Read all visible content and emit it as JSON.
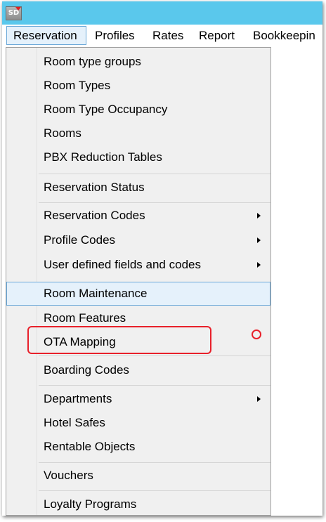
{
  "app": {
    "icon_text": "SD"
  },
  "menubar": {
    "items": [
      {
        "label": "Reservation",
        "active": true
      },
      {
        "label": "Profiles"
      },
      {
        "label": "Rates"
      },
      {
        "label": "Report"
      },
      {
        "label": "Bookkeepin"
      }
    ]
  },
  "dropdown": {
    "items": [
      {
        "label": "Room type groups"
      },
      {
        "label": "Room Types"
      },
      {
        "label": "Room Type Occupancy"
      },
      {
        "label": "Rooms"
      },
      {
        "label": "PBX Reduction Tables"
      },
      {
        "label": "Reservation Status"
      },
      {
        "label": "Reservation Codes",
        "has_submenu": true
      },
      {
        "label": "Profile Codes",
        "has_submenu": true
      },
      {
        "label": "User defined fields and codes",
        "has_submenu": true
      },
      {
        "label": "Room Maintenance",
        "highlighted": true
      },
      {
        "label": "Room Features"
      },
      {
        "label": "OTA Mapping",
        "annotated": true
      },
      {
        "label": "Boarding Codes"
      },
      {
        "label": "Departments",
        "has_submenu": true
      },
      {
        "label": "Hotel Safes"
      },
      {
        "label": "Rentable Objects"
      },
      {
        "label": "Vouchers"
      },
      {
        "label": "Loyalty Programs"
      }
    ]
  },
  "colors": {
    "titlebar": "#5ac8ec",
    "menu_background": "#f0f0f0",
    "highlight_fill": "#e5f1fb",
    "highlight_border": "#6aa8d8",
    "annotation": "#e8202a"
  }
}
